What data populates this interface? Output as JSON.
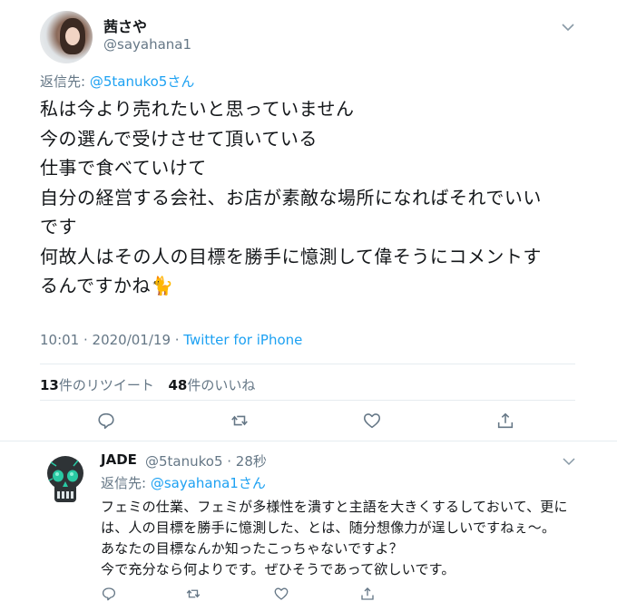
{
  "tweet": {
    "display_name": "茜さや",
    "handle": "@sayahana1",
    "reply_prefix": "返信先: ",
    "reply_target": "@5tanuko5さん",
    "text": "私は今より売れたいと思っていません\n今の選んで受けさせて頂いている\n仕事で食べていけて\n自分の経営する会社、お店が素敵な場所になればそれでいい\nです\n何故人はその人の目標を勝手に憶測して偉そうにコメントす\nるんですかね🐈",
    "time_date": "10:01 · 2020/01/19 · ",
    "client": "Twitter for iPhone",
    "retweets_count": "13",
    "retweets_label": "件のリツイート",
    "likes_count": "48",
    "likes_label": "件のいいね"
  },
  "reply": {
    "display_name": "JADE",
    "handle_time": "@5tanuko5 · 28秒",
    "reply_prefix": "返信先: ",
    "reply_target": "@sayahana1さん",
    "text": "フェミの仕業、フェミが多様性を潰すと主語を大きくするしておいて、更に\nは、人の目標を勝手に憶測した、とは、随分想像力が逞しいですねぇ〜。\nあなたの目標なんか知ったこっちゃないですよ？\n今で充分なら何よりです。ぜひそうであって欲しいです。"
  },
  "colors": {
    "accent": "#1da1f2",
    "secondary_text": "#657786",
    "divider": "#e6ecf0",
    "icon": "#657786"
  },
  "icons": [
    "chevron-down-icon",
    "reply-icon",
    "retweet-icon",
    "like-icon",
    "share-icon"
  ]
}
